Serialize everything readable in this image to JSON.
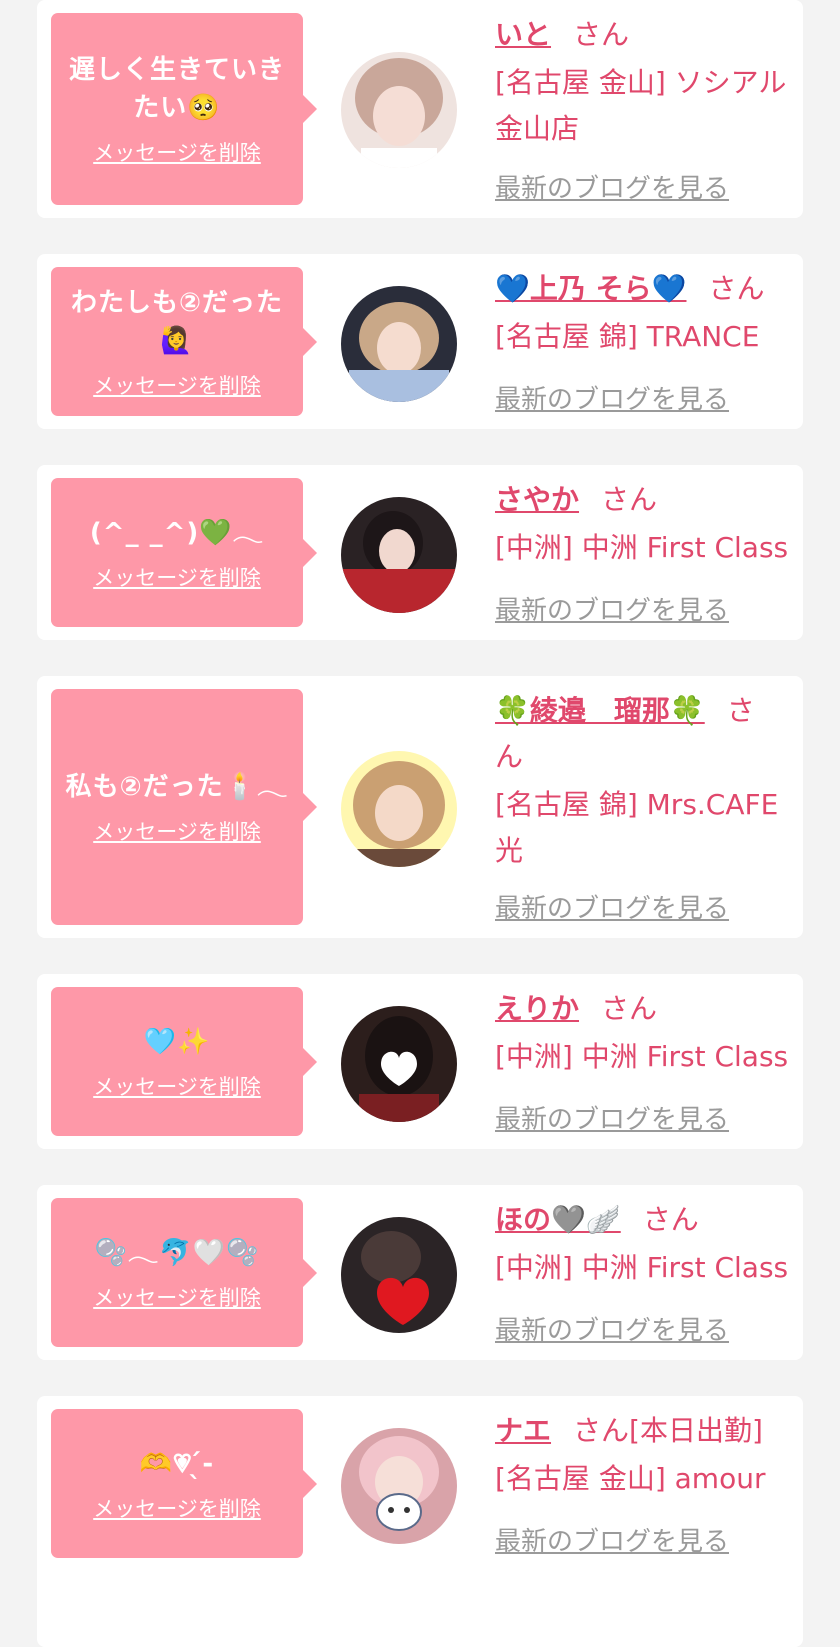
{
  "items": [
    {
      "message_line1": "遅しく生きていき",
      "message_line2": "たい🥺",
      "delete_label": "メッセージを削除",
      "name": "いと",
      "honorific": "さん",
      "shop_line1": "[名古屋 金山] ソシアル",
      "shop_line2": "金山店",
      "blog_label": "最新のブログを見る",
      "avatar_color": "#e9d4cf"
    },
    {
      "message_line1": "わたしも②だった",
      "message_line2": "🙋‍♀️",
      "delete_label": "メッセージを削除",
      "name": "💙上乃 そら💙",
      "honorific": "さん",
      "shop_line1": "[名古屋 錦] TRANCE",
      "shop_line2": "",
      "blog_label": "最新のブログを見る",
      "avatar_color": "#b9c9e2"
    },
    {
      "message_line1": "(^_ _^)💚𓂃",
      "message_line2": "",
      "delete_label": "メッセージを削除",
      "name": "さやか",
      "honorific": "さん",
      "shop_line1": "[中洲] 中洲 First Class",
      "shop_line2": "",
      "blog_label": "最新のブログを見る",
      "avatar_color": "#b8262e"
    },
    {
      "message_line1": "私も②だった🕯️𓂃",
      "message_line2": "",
      "delete_label": "メッセージを削除",
      "name": "🍀綾邉　瑠那🍀",
      "honorific": "さ",
      "honorific_wrap": "ん",
      "shop_line1": "[名古屋 錦] Mrs.CAFE",
      "shop_line2": "光",
      "blog_label": "最新のブログを見る",
      "avatar_color": "#d7a77d"
    },
    {
      "message_line1": "🩵✨",
      "message_line2": "",
      "delete_label": "メッセージを削除",
      "name": "えりか",
      "honorific": "さん",
      "shop_line1": "[中洲] 中洲 First Class",
      "shop_line2": "",
      "blog_label": "最新のブログを見る",
      "avatar_color": "#3a2622"
    },
    {
      "message_line1": "🫧𓂃🐬🤍🫧",
      "message_line2": "",
      "delete_label": "メッセージを削除",
      "name": "ほの🩶🪽",
      "honorific": "さん",
      "shop_line1": "[中洲] 中洲 First Class",
      "shop_line2": "",
      "blog_label": "最新のブログを見る",
      "avatar_color": "#2b2426"
    },
    {
      "message_line1": "🫶💗︎ ̖́-",
      "message_line2": "",
      "delete_label": "メッセージを削除",
      "name": "ナエ",
      "honorific": "さん[本日出勤]",
      "shop_line1": "[名古屋 金山] amour",
      "shop_line2": "",
      "blog_label": "最新のブログを見る",
      "avatar_color": "#f1c6cf"
    }
  ],
  "colors": {
    "accent": "#e0486c",
    "bubble": "#fe98a8",
    "blog_link": "#9a9a9a",
    "background": "#f3f3f3"
  }
}
